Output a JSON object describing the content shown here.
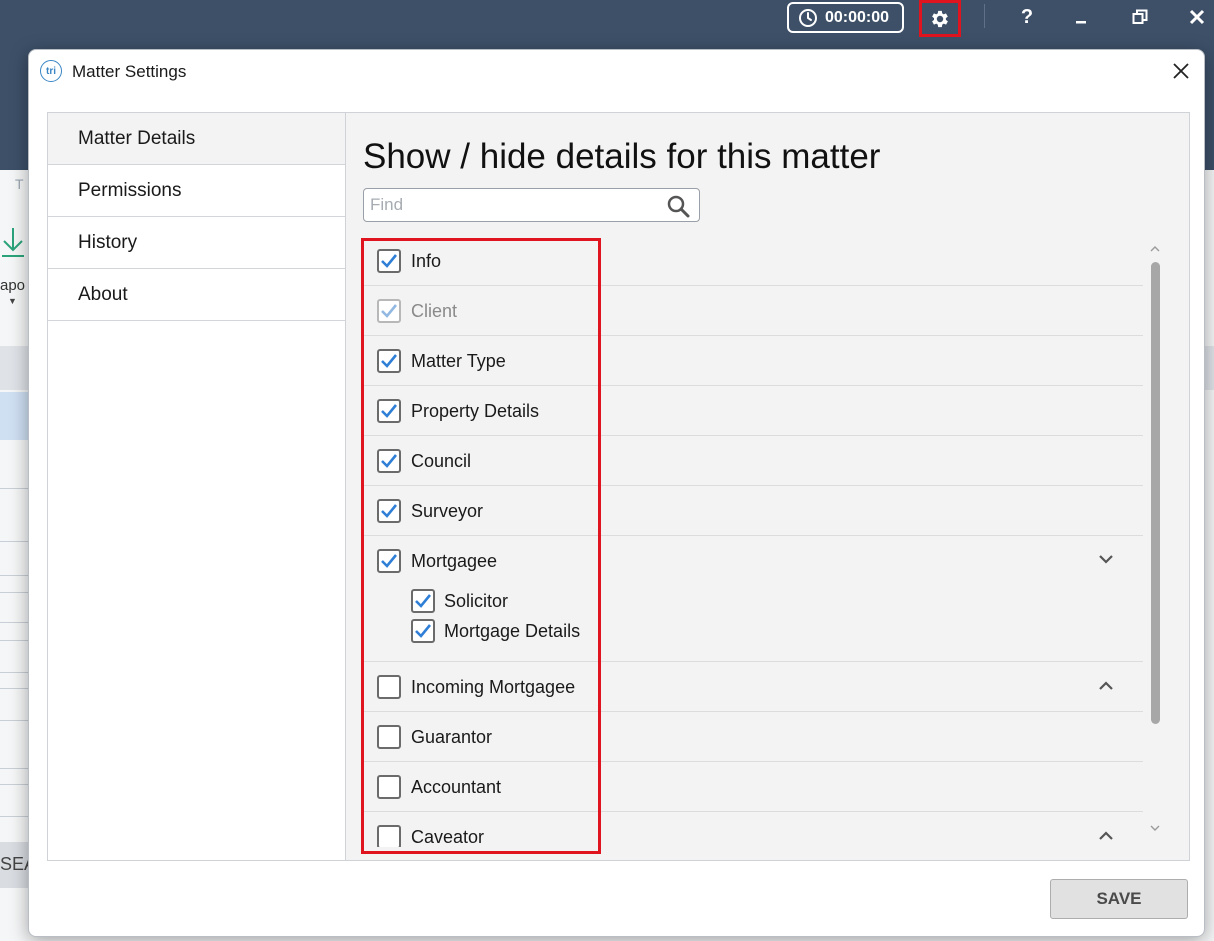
{
  "app": {
    "timer_text": "00:00:00",
    "help_label": "?",
    "bg_letter": "T",
    "bg_import_label": "apo",
    "bg_search_label": "SEA"
  },
  "dialog": {
    "title": "Matter Settings",
    "logo_text": "tri",
    "nav": [
      {
        "label": "Matter Details",
        "active": true
      },
      {
        "label": "Permissions",
        "active": false
      },
      {
        "label": "History",
        "active": false
      },
      {
        "label": "About",
        "active": false
      }
    ],
    "panel_title": "Show / hide details for this matter",
    "find_placeholder": "Find",
    "items": [
      {
        "label": "Info",
        "checked": true,
        "disabled": false
      },
      {
        "label": "Client",
        "checked": true,
        "disabled": true
      },
      {
        "label": "Matter Type",
        "checked": true,
        "disabled": false
      },
      {
        "label": "Property Details",
        "checked": true,
        "disabled": false
      },
      {
        "label": "Council",
        "checked": true,
        "disabled": false
      },
      {
        "label": "Surveyor",
        "checked": true,
        "disabled": false
      },
      {
        "label": "Mortgagee",
        "checked": true,
        "disabled": false,
        "expander": "chevron-down",
        "children": [
          {
            "label": "Solicitor",
            "checked": true
          },
          {
            "label": "Mortgage Details",
            "checked": true
          }
        ]
      },
      {
        "label": "Incoming Mortgagee",
        "checked": false,
        "disabled": false,
        "expander": "chevron-up"
      },
      {
        "label": "Guarantor",
        "checked": false,
        "disabled": false
      },
      {
        "label": "Accountant",
        "checked": false,
        "disabled": false
      },
      {
        "label": "Caveator",
        "checked": false,
        "disabled": false,
        "expander": "chevron-up"
      }
    ],
    "save_label": "SAVE"
  },
  "colors": {
    "titlebar": "#3d5068",
    "check_blue": "#2f7fd6",
    "highlight_red": "#e0141e"
  }
}
